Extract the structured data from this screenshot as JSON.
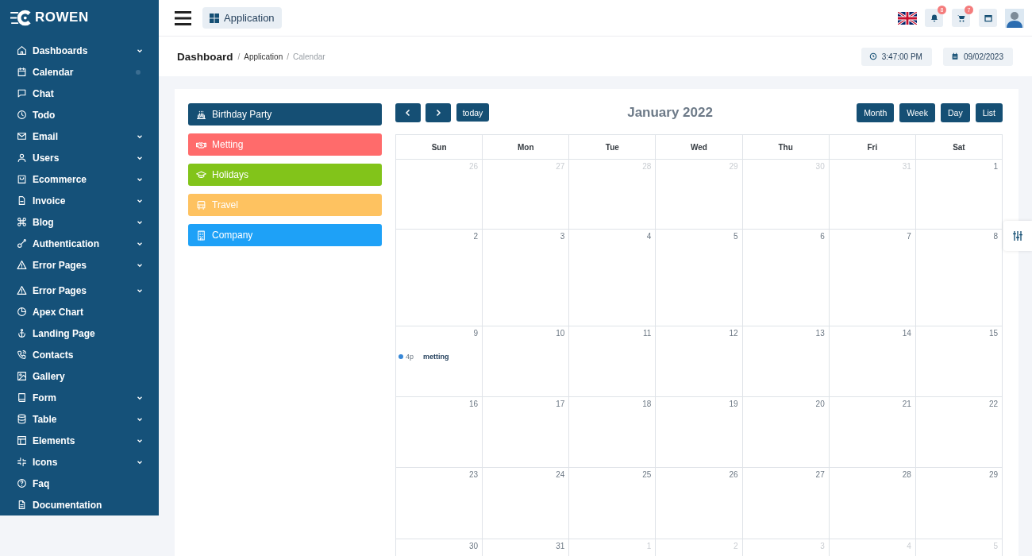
{
  "sidebar": {
    "brand": "ROWEN",
    "items": [
      {
        "label": "Dashboards",
        "expandable": true,
        "selected": false
      },
      {
        "label": "Calendar",
        "expandable": false,
        "selected": true
      },
      {
        "label": "Chat",
        "expandable": false,
        "selected": false
      },
      {
        "label": "Todo",
        "expandable": false,
        "selected": false
      },
      {
        "label": "Email",
        "expandable": true,
        "selected": false
      },
      {
        "label": "Users",
        "expandable": true,
        "selected": false
      },
      {
        "label": "Ecommerce",
        "expandable": true,
        "selected": false
      },
      {
        "label": "Invoice",
        "expandable": true,
        "selected": false
      },
      {
        "label": "Blog",
        "expandable": true,
        "selected": false
      },
      {
        "label": "Authentication",
        "expandable": true,
        "selected": false
      },
      {
        "label": "Error Pages",
        "expandable": true,
        "selected": false
      },
      {
        "label": "Error Pages",
        "expandable": true,
        "selected": false
      },
      {
        "label": "Apex Chart",
        "expandable": false,
        "selected": false
      },
      {
        "label": "Landing Page",
        "expandable": false,
        "selected": false
      },
      {
        "label": "Contacts",
        "expandable": false,
        "selected": false
      },
      {
        "label": "Gallery",
        "expandable": false,
        "selected": false
      },
      {
        "label": "Form",
        "expandable": true,
        "selected": false
      },
      {
        "label": "Table",
        "expandable": true,
        "selected": false
      },
      {
        "label": "Elements",
        "expandable": true,
        "selected": false
      },
      {
        "label": "Icons",
        "expandable": true,
        "selected": false
      },
      {
        "label": "Faq",
        "expandable": false,
        "selected": false
      },
      {
        "label": "Documentation",
        "expandable": false,
        "selected": false
      }
    ]
  },
  "header": {
    "app_button": "Application",
    "notifications": "8",
    "cart": "7"
  },
  "breadcrumb": {
    "title": "Dashboard",
    "items": [
      {
        "separator": "/",
        "label": "Application",
        "current": false
      },
      {
        "separator": "/",
        "label": "Calendar",
        "current": true
      }
    ],
    "time": "3:47:00 PM",
    "date": "09/02/2023"
  },
  "event_types": [
    {
      "label": "Birthday Party",
      "color": "#154f74"
    },
    {
      "label": "Metting",
      "color": "#ff6b6b"
    },
    {
      "label": "Holidays",
      "color": "#82c41a"
    },
    {
      "label": "Travel",
      "color": "#fec260"
    },
    {
      "label": "Company",
      "color": "#1ea1f7"
    }
  ],
  "calendar": {
    "today_button": "today",
    "title": "January 2022",
    "views": [
      "Month",
      "Week",
      "Day",
      "List"
    ],
    "weekdays": [
      "Sun",
      "Mon",
      "Tue",
      "Wed",
      "Thu",
      "Fri",
      "Sat"
    ],
    "weeks": [
      {
        "days": [
          {
            "day": "26",
            "other_month": true
          },
          {
            "day": "27",
            "other_month": true
          },
          {
            "day": "28",
            "other_month": true
          },
          {
            "day": "29",
            "other_month": true
          },
          {
            "day": "30",
            "other_month": true
          },
          {
            "day": "31",
            "other_month": true
          },
          {
            "day": "1",
            "other_month": false
          }
        ]
      },
      {
        "days": [
          {
            "day": "2",
            "other_month": false
          },
          {
            "day": "3",
            "other_month": false
          },
          {
            "day": "4",
            "other_month": false
          },
          {
            "day": "5",
            "other_month": false
          },
          {
            "day": "6",
            "other_month": false
          },
          {
            "day": "7",
            "other_month": false
          },
          {
            "day": "8",
            "other_month": false
          }
        ]
      },
      {
        "days": [
          {
            "day": "9",
            "other_month": false,
            "events": [
              {
                "time": "4p",
                "title": "metting"
              }
            ]
          },
          {
            "day": "10",
            "other_month": false
          },
          {
            "day": "11",
            "other_month": false
          },
          {
            "day": "12",
            "other_month": false
          },
          {
            "day": "13",
            "other_month": false
          },
          {
            "day": "14",
            "other_month": false
          },
          {
            "day": "15",
            "other_month": false
          }
        ]
      },
      {
        "days": [
          {
            "day": "16",
            "other_month": false
          },
          {
            "day": "17",
            "other_month": false
          },
          {
            "day": "18",
            "other_month": false
          },
          {
            "day": "19",
            "other_month": false
          },
          {
            "day": "20",
            "other_month": false
          },
          {
            "day": "21",
            "other_month": false
          },
          {
            "day": "22",
            "other_month": false
          }
        ]
      },
      {
        "days": [
          {
            "day": "23",
            "other_month": false
          },
          {
            "day": "24",
            "other_month": false
          },
          {
            "day": "25",
            "other_month": false
          },
          {
            "day": "26",
            "other_month": false
          },
          {
            "day": "27",
            "other_month": false
          },
          {
            "day": "28",
            "other_month": false
          },
          {
            "day": "29",
            "other_month": false
          }
        ]
      },
      {
        "days": [
          {
            "day": "30",
            "other_month": false
          },
          {
            "day": "31",
            "other_month": false
          },
          {
            "day": "1",
            "other_month": true
          },
          {
            "day": "2",
            "other_month": true
          },
          {
            "day": "3",
            "other_month": true
          },
          {
            "day": "4",
            "other_month": true
          },
          {
            "day": "5",
            "other_month": true
          }
        ]
      }
    ]
  }
}
